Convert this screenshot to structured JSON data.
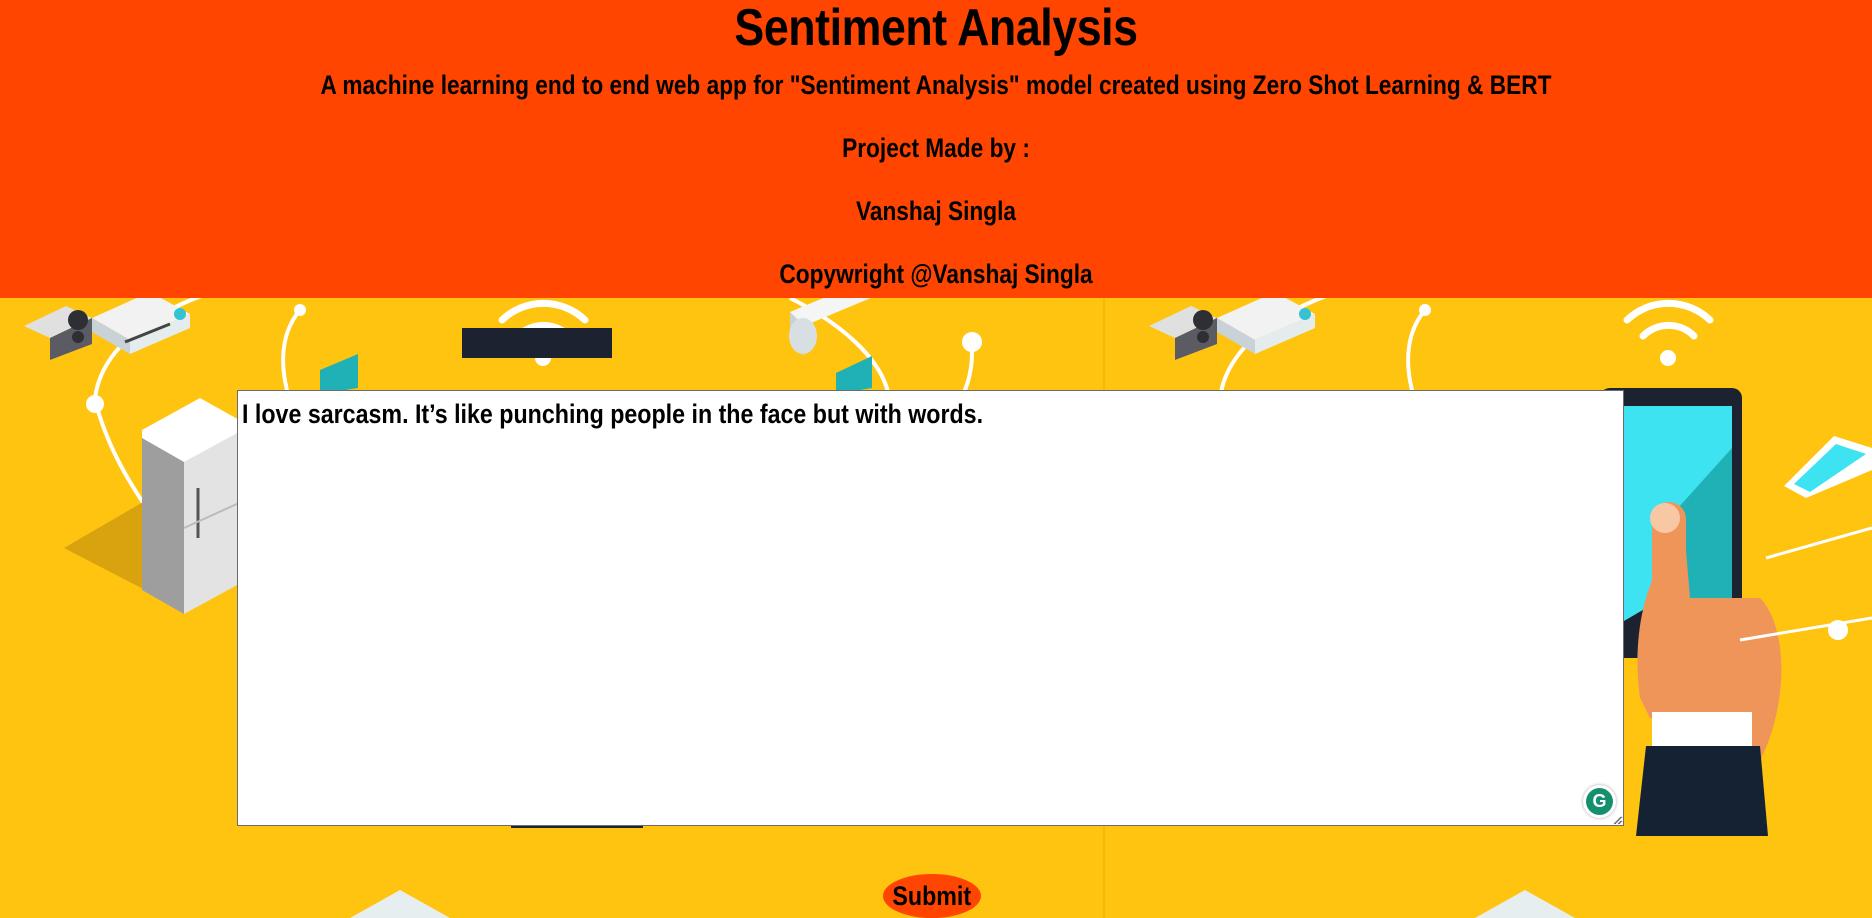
{
  "header": {
    "title": "Sentiment Analysis",
    "subtitle_prefix": "A machine learning end to end web app for ",
    "subtitle_highlight": "\"Sentiment Analysis\"",
    "subtitle_suffix": " model created using Zero Shot Learning & BERT",
    "made_by_label": "Project Made by :",
    "author": "Vanshaj Singla",
    "copyright": "Copywright @Vanshaj Singla"
  },
  "form": {
    "input_value": "I love sarcasm. It’s like punching people in the face but with words.",
    "submit_label": "Submit",
    "grammarly_glyph": "G"
  },
  "colors": {
    "banner": "#FF4500",
    "background": "#FFC40F",
    "submit": "#FF4500",
    "grammarly": "#15906F"
  },
  "icons": [
    "grammarly-icon",
    "resize-handle-icon"
  ]
}
